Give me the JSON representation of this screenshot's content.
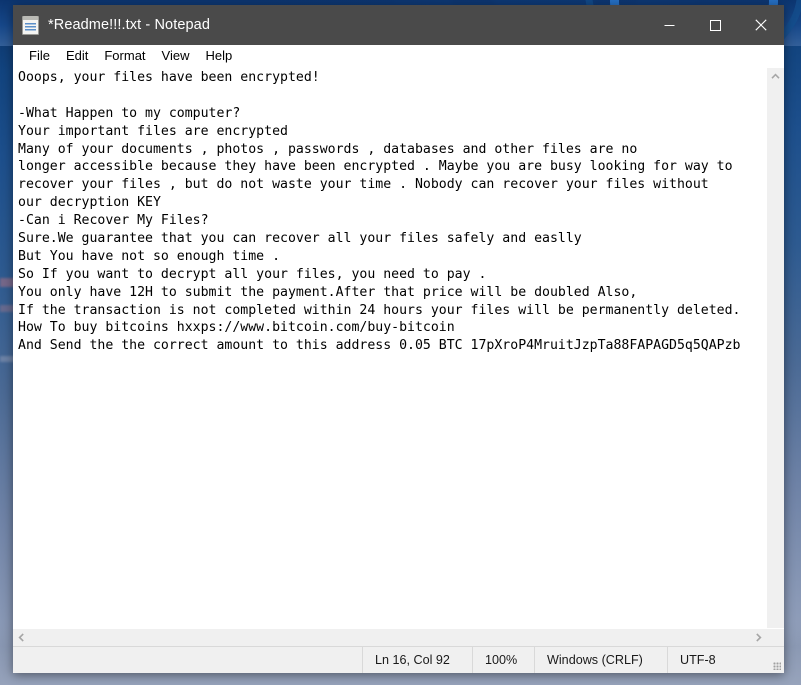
{
  "window": {
    "title": "*Readme!!!.txt - Notepad",
    "app_icon": "notepad-icon",
    "controls": {
      "minimize": "minimize-icon",
      "maximize": "maximize-icon",
      "close": "close-icon"
    }
  },
  "menubar": {
    "items": [
      {
        "label": "File"
      },
      {
        "label": "Edit"
      },
      {
        "label": "Format"
      },
      {
        "label": "View"
      },
      {
        "label": "Help"
      }
    ]
  },
  "document": {
    "lines": [
      "Ooops, your files have been encrypted!",
      "",
      "-What Happen to my computer?",
      "Your important files are encrypted",
      "Many of your documents , photos , passwords , databases and other files are no",
      "longer accessible because they have been encrypted . Maybe you are busy looking for way to",
      "recover your files , but do not waste your time . Nobody can recover your files without",
      "our decryption KEY",
      "-Can i Recover My Files?",
      "Sure.We guarantee that you can recover all your files safely and easlly",
      "But You have not so enough time .",
      "So If you want to decrypt all your files, you need to pay .",
      "You only have 12H to submit the payment.After that price will be doubled Also,",
      "If the transaction is not completed within 24 hours your files will be permanently deleted.",
      "How To buy bitcoins hxxps://www.bitcoin.com/buy-bitcoin",
      "And Send the the correct amount to this address 0.05 BTC 17pXroP4MruitJzpTa88FAPAGD5q5QAPzb"
    ]
  },
  "scrollbars": {
    "vertical_up_arrow": "chevron-up-icon",
    "horizontal_left_arrow": "chevron-left-icon",
    "horizontal_right_arrow": "chevron-right-icon"
  },
  "statusbar": {
    "position": "Ln 16, Col 92",
    "zoom": "100%",
    "line_ending": "Windows (CRLF)",
    "encoding": "UTF-8"
  },
  "colors": {
    "titlebar_bg": "#4a4a4a",
    "titlebar_text": "#ffffff",
    "editor_bg": "#ffffff",
    "editor_text": "#000000",
    "chrome_bg": "#f0f0f0",
    "desktop_accent": "#1b63b8"
  }
}
